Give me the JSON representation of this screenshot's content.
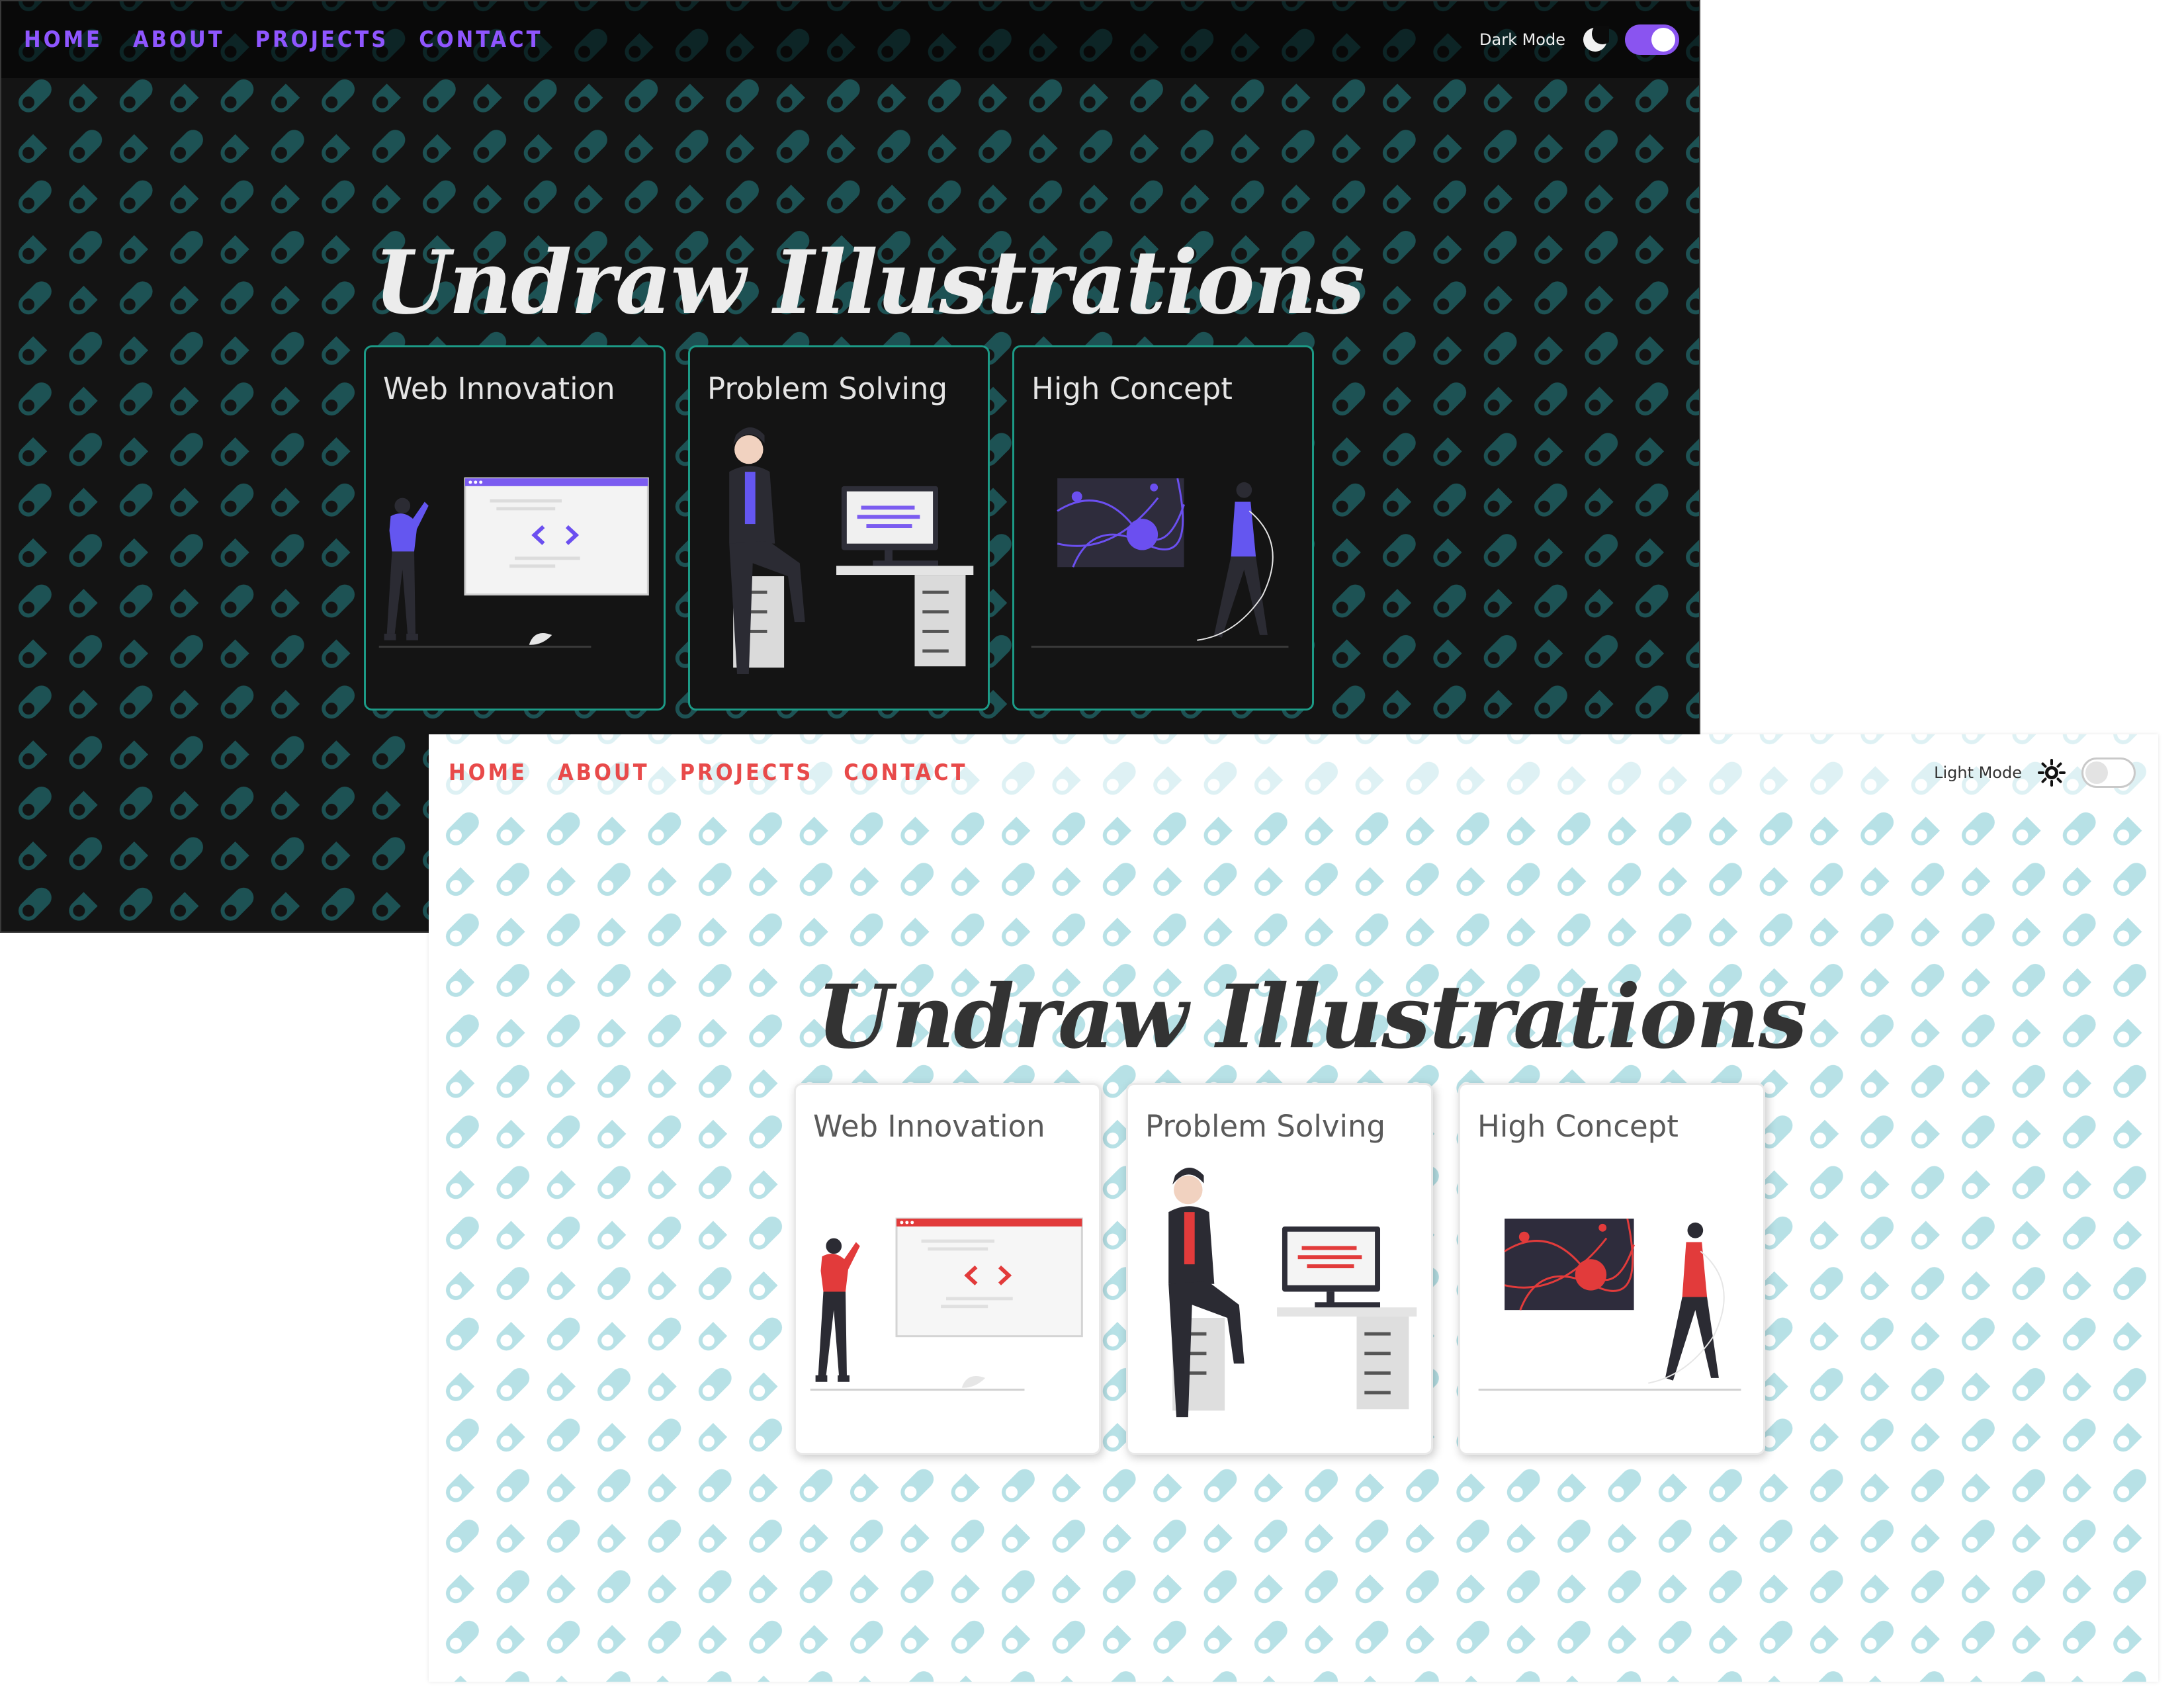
{
  "dark": {
    "nav": {
      "home": "HOME",
      "about": "ABOUT",
      "projects": "PROJECTS",
      "contact": "CONTACT"
    },
    "mode_label": "Dark Mode",
    "mode_icon": "moon-icon",
    "toggle_on": true,
    "title": "Undraw Illustrations",
    "cards": [
      {
        "title": "Web Innovation",
        "illustration": "web-developer-illustration"
      },
      {
        "title": "Problem Solving",
        "illustration": "person-at-desk-illustration"
      },
      {
        "title": "High Concept",
        "illustration": "walking-woman-abstract-illustration"
      }
    ],
    "colors": {
      "background": "#141414",
      "accent": "#8f56ff",
      "card_border": "#1c9a86",
      "pattern": "#1d5254"
    }
  },
  "light": {
    "nav": {
      "home": "HOME",
      "about": "ABOUT",
      "projects": "PROJECTS",
      "contact": "CONTACT"
    },
    "mode_label": "Light Mode",
    "mode_icon": "sun-icon",
    "toggle_on": false,
    "title": "Undraw Illustrations",
    "cards": [
      {
        "title": "Web Innovation",
        "illustration": "web-developer-illustration"
      },
      {
        "title": "Problem Solving",
        "illustration": "person-at-desk-illustration"
      },
      {
        "title": "High Concept",
        "illustration": "walking-woman-abstract-illustration"
      }
    ],
    "colors": {
      "background": "#ffffff",
      "accent": "#e84a4a",
      "card_border": "#e9e9e9",
      "pattern": "#b7e1e6"
    }
  }
}
